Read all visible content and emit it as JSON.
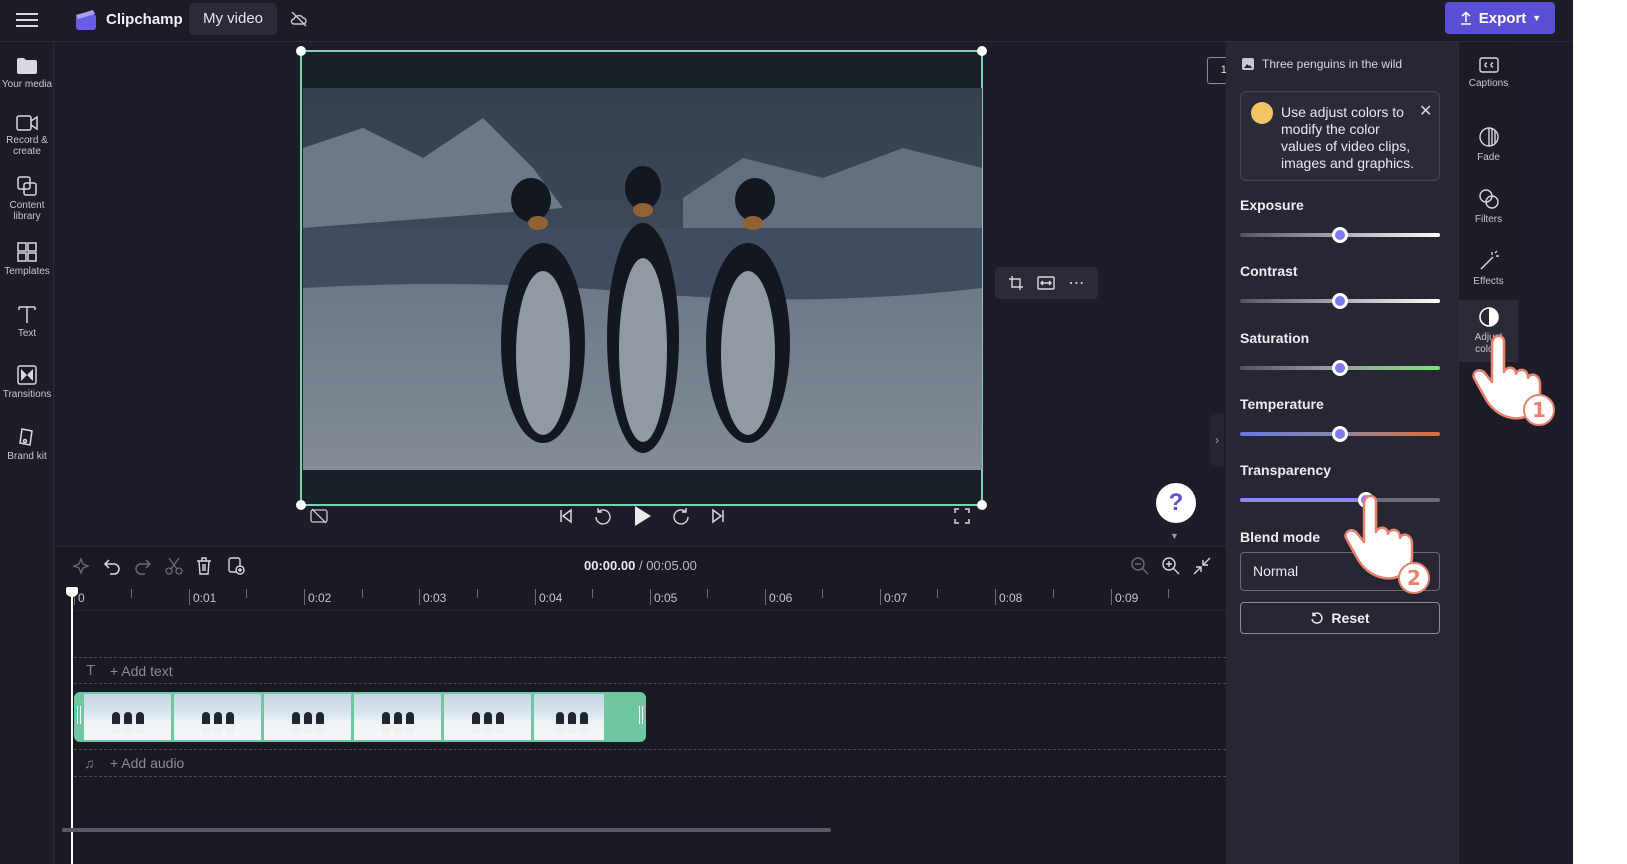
{
  "app": {
    "name": "Clipchamp",
    "project_title": "My video",
    "export_label": "Export"
  },
  "left_nav": [
    {
      "label": "Your media",
      "icon": "folder-icon"
    },
    {
      "label": "Record & create",
      "icon": "video-camera-icon"
    },
    {
      "label": "Content library",
      "icon": "content-library-icon"
    },
    {
      "label": "Templates",
      "icon": "templates-icon"
    },
    {
      "label": "Text",
      "icon": "text-icon"
    },
    {
      "label": "Transitions",
      "icon": "transitions-icon"
    },
    {
      "label": "Brand kit",
      "icon": "brand-kit-icon"
    }
  ],
  "preview": {
    "aspect_ratio": "16:9"
  },
  "timeline": {
    "current_time": "00:00.00",
    "separator": "/",
    "total_time": "00:05.00",
    "ruler_labels": [
      "0",
      "0:01",
      "0:02",
      "0:03",
      "0:04",
      "0:05",
      "0:06",
      "0:07",
      "0:08",
      "0:09"
    ],
    "add_text": "+ Add text",
    "add_audio": "+ Add audio"
  },
  "adjust_panel": {
    "clip_name": "Three penguins in the wild",
    "tip": "Use adjust colors to modify the color values of video clips, images and graphics.",
    "sliders": [
      {
        "label": "Exposure",
        "value": 0.5
      },
      {
        "label": "Contrast",
        "value": 0.5
      },
      {
        "label": "Saturation",
        "value": 0.5
      },
      {
        "label": "Temperature",
        "value": 0.5
      },
      {
        "label": "Transparency",
        "value": 0.63
      }
    ],
    "blend_mode_label": "Blend mode",
    "blend_mode_value": "Normal",
    "reset_label": "Reset"
  },
  "right_nav": [
    {
      "label": "Captions",
      "icon": "captions-icon"
    },
    {
      "label": "Fade",
      "icon": "fade-icon"
    },
    {
      "label": "Filters",
      "icon": "filters-icon"
    },
    {
      "label": "Effects",
      "icon": "effects-icon"
    },
    {
      "label": "Adjust colors",
      "icon": "adjust-colors-icon"
    }
  ],
  "annotations": {
    "step1": "1",
    "step2": "2"
  },
  "colors": {
    "accent": "#5b4fd6",
    "clip_border": "#6fc7a0",
    "slider_knob": "#7f7aed"
  }
}
